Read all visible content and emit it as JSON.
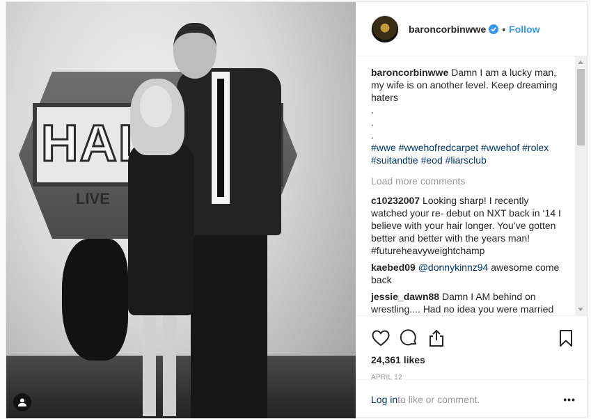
{
  "header": {
    "username": "baroncorbinwwe",
    "separator": "•",
    "follow_label": "Follow"
  },
  "caption": {
    "username": "baroncorbinwwe",
    "text": "Damn I am a lucky man, my wife is on another level. Keep dreaming haters",
    "dots": [
      ".",
      ".",
      "."
    ],
    "hashtags": "#wwe #wwehofredcarpet #wwehof #rolex #suitandtie #eod #liarsclub"
  },
  "load_more_label": "Load more comments",
  "comments": [
    {
      "username": "c10232007",
      "text": "Looking sharp! I recently watched your re- debut on NXT back in ‘14 I believe with your hair longer. You’ve gotten better and better with the years man! #futureheavyweightchamp"
    },
    {
      "username": "kaebed09",
      "mention": "@donnykinnz94",
      "text": "awesome come back"
    },
    {
      "username": "jessie_dawn88",
      "text": "Damn I AM behind on wrestling.... Had no idea you were married □□□. Guess you can no longer say you’re a"
    }
  ],
  "likes_label": "24,361 likes",
  "date_label": "APRIL 12",
  "footer": {
    "login_label": "Log in",
    "rest_label": " to like or comment.",
    "more_label": "•••"
  },
  "photo_sign": {
    "title": "HALL",
    "subtitle": "LIVE"
  },
  "icons": {
    "like": "heart-icon",
    "comment": "comment-icon",
    "share": "share-icon",
    "save": "bookmark-icon",
    "tag": "user-tag-icon",
    "verified": "verified-badge-icon"
  },
  "colors": {
    "link": "#3897f0",
    "hashtag": "#003569",
    "muted": "#999999"
  }
}
